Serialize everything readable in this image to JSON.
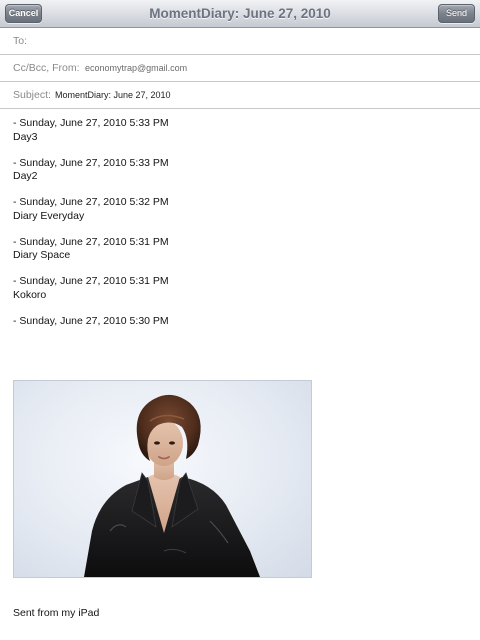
{
  "navbar": {
    "cancel_label": "Cancel",
    "title": "MomentDiary: June 27, 2010",
    "send_label": "Send"
  },
  "fields": {
    "to": {
      "label": "To:",
      "value": ""
    },
    "cc_bcc_from": {
      "label": "Cc/Bcc, From:",
      "value": "economytrap@gmail.com"
    },
    "subject": {
      "label": "Subject:",
      "value": "MomentDiary: June 27, 2010"
    }
  },
  "body": {
    "entries": [
      {
        "timestamp": "- Sunday, June 27, 2010 5:33 PM",
        "title": "Day3"
      },
      {
        "timestamp": "- Sunday, June 27, 2010 5:33 PM",
        "title": "Day2"
      },
      {
        "timestamp": "- Sunday, June 27, 2010 5:32 PM",
        "title": "Diary Everyday"
      },
      {
        "timestamp": "- Sunday, June 27, 2010 5:31 PM",
        "title": "Diary Space"
      },
      {
        "timestamp": "- Sunday, June 27, 2010 5:31 PM",
        "title": "Kokoro"
      },
      {
        "timestamp": "- Sunday, June 27, 2010 5:30 PM",
        "title": ""
      }
    ],
    "attachment": {
      "kind": "photo",
      "subject": "woman with short brown hair in black leather jacket"
    },
    "signature": "Sent from my iPad"
  }
}
